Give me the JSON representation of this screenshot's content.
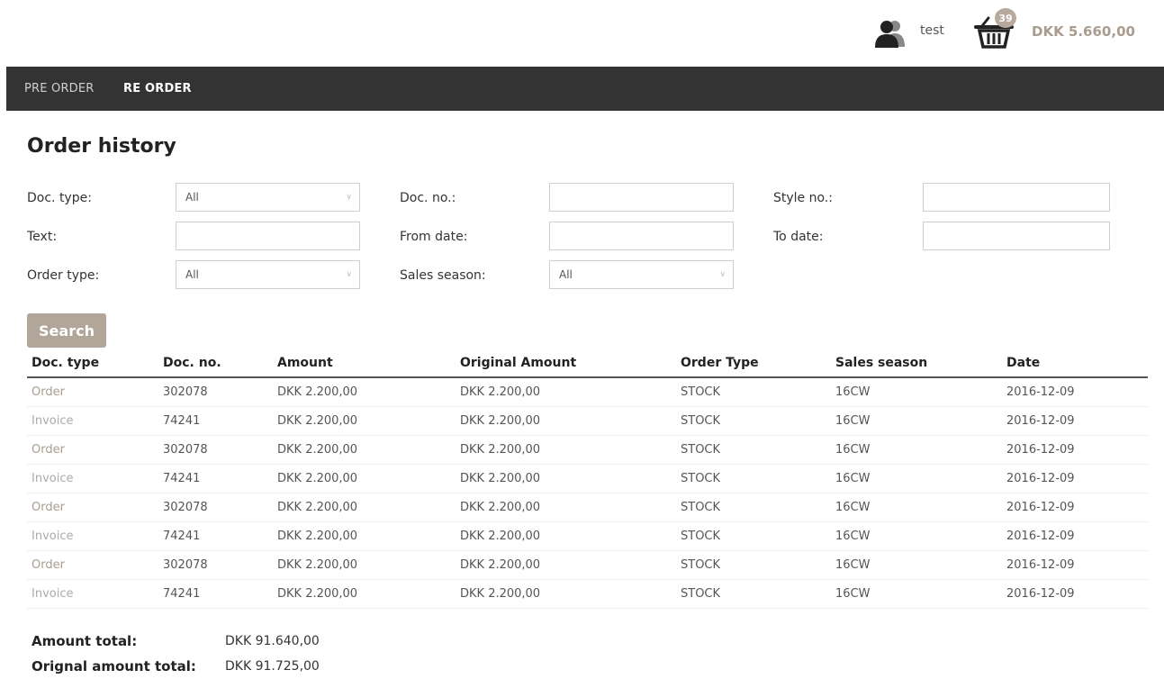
{
  "header": {
    "user_name": "test",
    "cart_count": "39",
    "cart_total": "DKK 5.660,00",
    "icons": {
      "user": "user-group-icon",
      "cart": "basket-icon"
    }
  },
  "nav": {
    "items": [
      {
        "label": "PRE ORDER",
        "active": false
      },
      {
        "label": "RE ORDER",
        "active": true
      }
    ]
  },
  "page_title": "Order history",
  "filters": {
    "doc_type": {
      "label": "Doc. type:",
      "value": "All"
    },
    "doc_no": {
      "label": "Doc. no.:",
      "value": ""
    },
    "style_no": {
      "label": "Style no.:",
      "value": ""
    },
    "text": {
      "label": "Text:",
      "value": ""
    },
    "from_date": {
      "label": "From date:",
      "value": ""
    },
    "to_date": {
      "label": "To date:",
      "value": ""
    },
    "order_type": {
      "label": "Order type:",
      "value": "All"
    },
    "sales_season": {
      "label": "Sales season:",
      "value": "All"
    }
  },
  "search_label": "Search",
  "table": {
    "columns": [
      "Doc. type",
      "Doc. no.",
      "Amount",
      "Original Amount",
      "Order Type",
      "Sales season",
      "Date"
    ],
    "rows": [
      [
        "Order",
        "302078",
        "DKK 2.200,00",
        "DKK 2.200,00",
        "STOCK",
        "16CW",
        "2016-12-09"
      ],
      [
        "Invoice",
        "74241",
        "DKK 2.200,00",
        "DKK 2.200,00",
        "STOCK",
        "16CW",
        "2016-12-09"
      ],
      [
        "Order",
        "302078",
        "DKK 2.200,00",
        "DKK 2.200,00",
        "STOCK",
        "16CW",
        "2016-12-09"
      ],
      [
        "Invoice",
        "74241",
        "DKK 2.200,00",
        "DKK 2.200,00",
        "STOCK",
        "16CW",
        "2016-12-09"
      ],
      [
        "Order",
        "302078",
        "DKK 2.200,00",
        "DKK 2.200,00",
        "STOCK",
        "16CW",
        "2016-12-09"
      ],
      [
        "Invoice",
        "74241",
        "DKK 2.200,00",
        "DKK 2.200,00",
        "STOCK",
        "16CW",
        "2016-12-09"
      ],
      [
        "Order",
        "302078",
        "DKK 2.200,00",
        "DKK 2.200,00",
        "STOCK",
        "16CW",
        "2016-12-09"
      ],
      [
        "Invoice",
        "74241",
        "DKK 2.200,00",
        "DKK 2.200,00",
        "STOCK",
        "16CW",
        "2016-12-09"
      ]
    ]
  },
  "totals": {
    "amount_label": "Amount total:",
    "amount_value": "DKK 91.640,00",
    "original_label": "Orignal amount total:",
    "original_value": "DKK 91.725,00"
  },
  "colors": {
    "navbar": "#333333",
    "accent": "#b2a69a",
    "doc_type_order": "#a89c8f"
  }
}
